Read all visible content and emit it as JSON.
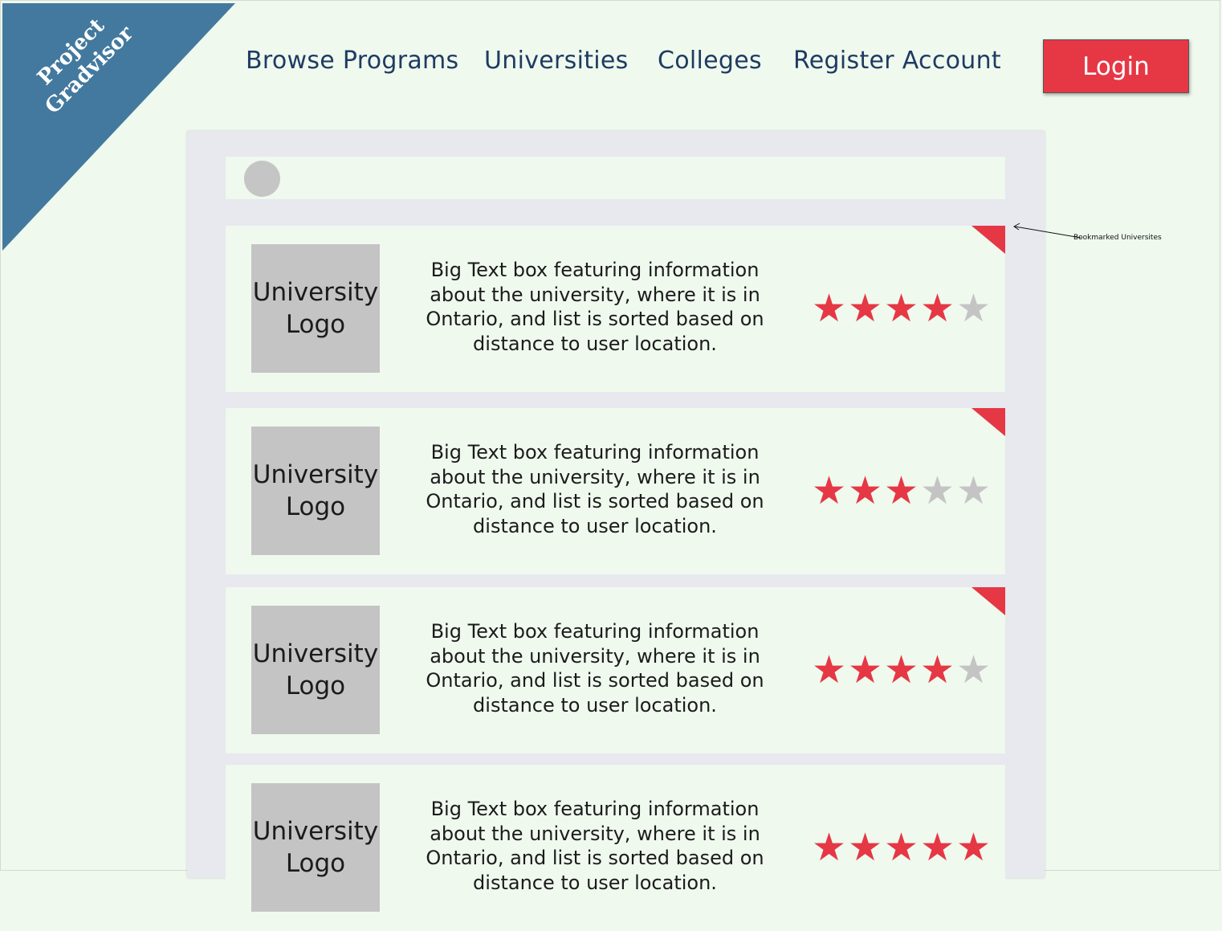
{
  "brand": {
    "line1": "Project",
    "line2": "Gradvisor",
    "color": "#43799e"
  },
  "nav": {
    "browse_programs": "Browse Programs",
    "universities": "Universities",
    "colleges": "Colleges",
    "register_account": "Register Account",
    "login": "Login"
  },
  "colors": {
    "accent": "#e63745",
    "background": "#eff9ee",
    "panel": "#e8e8ef",
    "text": "#1f3b62",
    "star_empty": "#c4c4c4"
  },
  "annotation": {
    "bookmark_note": "Bookmarked Universites"
  },
  "universities": [
    {
      "logo_line1": "University",
      "logo_line2": "Logo",
      "description": "Big Text box featuring information about the university, where it is in Ontario, and list is sorted based on distance to user location.",
      "rating": 4,
      "rating_max": 5,
      "bookmarked": true
    },
    {
      "logo_line1": "University",
      "logo_line2": "Logo",
      "description": "Big Text box featuring information about the university, where it is in Ontario, and list is sorted based on distance to user location.",
      "rating": 3,
      "rating_max": 5,
      "bookmarked": true
    },
    {
      "logo_line1": "University",
      "logo_line2": "Logo",
      "description": "Big Text box featuring information about the university, where it is in Ontario, and list is sorted based on distance to user location.",
      "rating": 4,
      "rating_max": 5,
      "bookmarked": true
    },
    {
      "logo_line1": "University",
      "logo_line2": "Logo",
      "description": "Big Text box featuring information about the university, where it is in Ontario, and list is sorted based on distance to user location.",
      "rating": 5,
      "rating_max": 5,
      "bookmarked": false
    }
  ]
}
